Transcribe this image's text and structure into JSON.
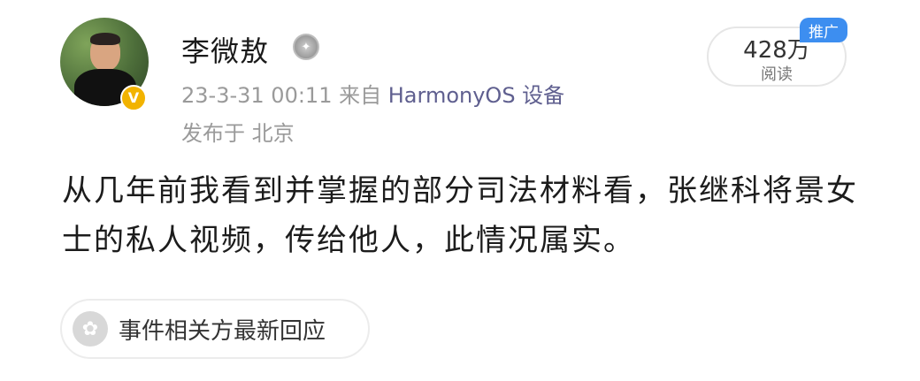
{
  "user": {
    "name": "李微敖",
    "avatar_icon": "avatar-photo",
    "verified_icon": "verified-badge-icon",
    "medal_icon": "medal-icon"
  },
  "post_meta": {
    "datetime": "23-3-31 00:11",
    "source_prefix": "来自",
    "source": "HarmonyOS 设备",
    "location": "发布于 北京"
  },
  "reads": {
    "count": "428万",
    "label": "阅读"
  },
  "promo_badge": "推广",
  "post": {
    "text": "从几年前我看到并掌握的部分司法材料看，张继科将景女士的私人视频，传给他人，此情况属实。"
  },
  "event_chip": {
    "label": "事件相关方最新回应",
    "icon": "flower-icon"
  },
  "colors": {
    "accent": "#3d8ef0",
    "verified": "#f2b300",
    "meta_text": "#9a9a9a"
  }
}
